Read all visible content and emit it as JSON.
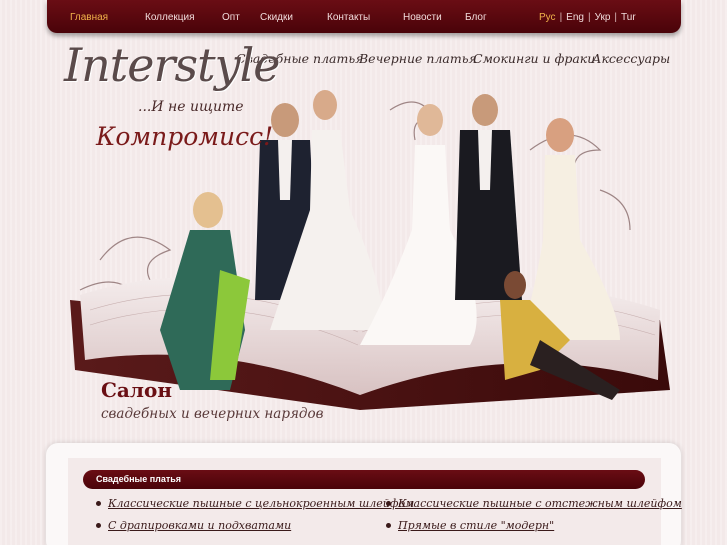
{
  "nav": {
    "items": [
      {
        "label": "Главная",
        "active": true
      },
      {
        "label": "Коллекция"
      },
      {
        "label": "Опт"
      },
      {
        "label": "Скидки"
      },
      {
        "label": "Контакты"
      },
      {
        "label": "Новости"
      },
      {
        "label": "Блог"
      }
    ],
    "languages": [
      "Рус",
      "Eng",
      "Укр",
      "Tur"
    ],
    "current_language": "Рус"
  },
  "categories": [
    "Свадебные платья",
    "Вечерние платья",
    "Смокинги и фраки",
    "Аксессуары"
  ],
  "brand": {
    "logo": "Interstyle",
    "tagline": "...И не ищите",
    "slogan": "Компромисс!"
  },
  "hero": {
    "title": "Салон",
    "subtitle": "свадебных и вечерних нарядов"
  },
  "section": {
    "title": "Свадебные платья",
    "links_left": [
      "Классические пышные с цельнокроенным шлейфом",
      "С драпировками и подхватами"
    ],
    "links_right": [
      "Классические пышные с отстежным шлейфом",
      "Прямые в стиле \"модерн\""
    ]
  },
  "colors": {
    "accent": "#5a060d",
    "active_nav": "#f0b24a",
    "background": "#f3e9e9"
  }
}
